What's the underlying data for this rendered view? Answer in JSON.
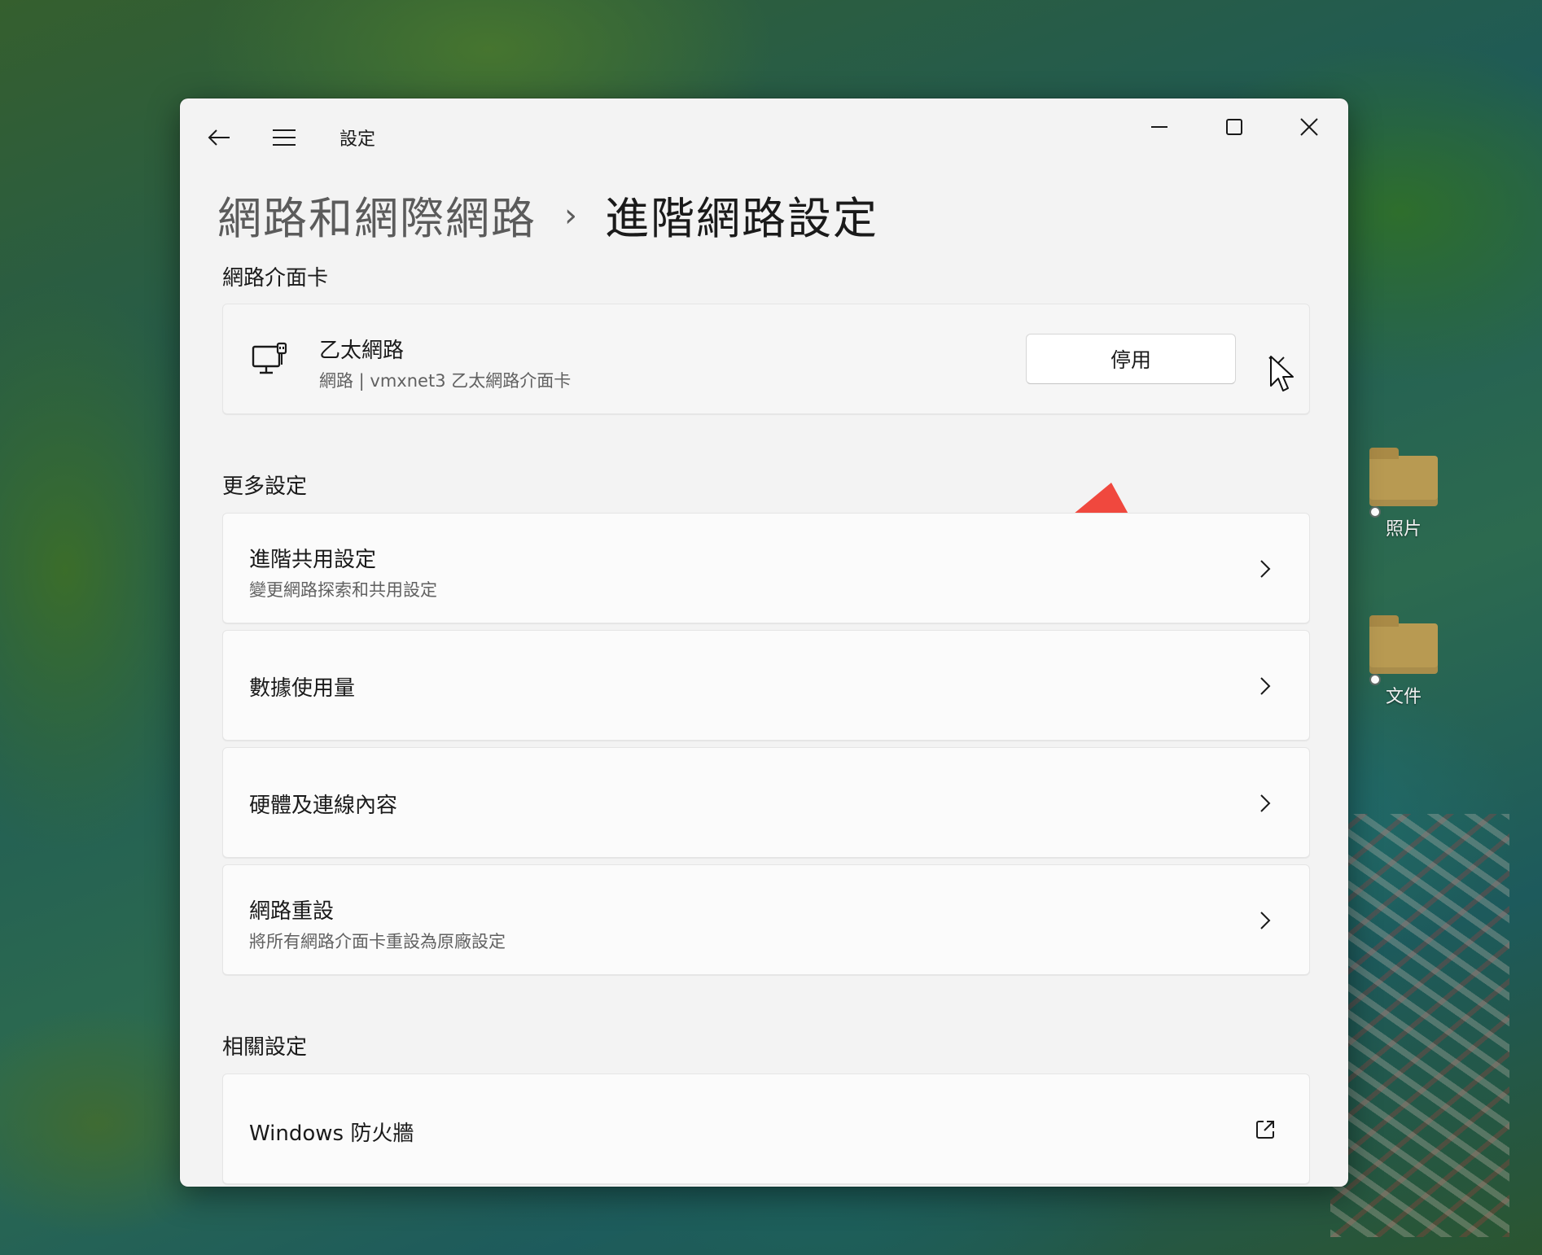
{
  "desktop": {
    "icons": [
      {
        "label": "照片"
      },
      {
        "label": "文件"
      }
    ]
  },
  "window": {
    "app_title": "設定",
    "breadcrumb": {
      "parent": "網路和網際網路",
      "separator": "›",
      "current": "進階網路設定"
    },
    "sections": {
      "adapters": "網路介面卡",
      "more": "更多設定",
      "related": "相關設定"
    },
    "adapter": {
      "name": "乙太網路",
      "description": "網路 | vmxnet3 乙太網路介面卡",
      "disable_label": "停用"
    },
    "more_items": [
      {
        "title": "進階共用設定",
        "subtitle": "變更網路探索和共用設定"
      },
      {
        "title": "數據使用量",
        "subtitle": ""
      },
      {
        "title": "硬體及連線內容",
        "subtitle": ""
      },
      {
        "title": "網路重設",
        "subtitle": "將所有網路介面卡重設為原廠設定"
      }
    ],
    "related_items": [
      {
        "title": "Windows 防火牆"
      }
    ],
    "icons": {
      "back": "back-arrow-icon",
      "menu": "hamburger-menu-icon",
      "minimize": "minimize-icon",
      "maximize": "maximize-icon",
      "close": "close-icon",
      "adapter": "ethernet-computer-icon",
      "chevron": "chevron-right-icon",
      "external": "external-link-icon"
    },
    "colors": {
      "annotation_arrow": "#f0483e",
      "window_bg": "#f3f3f3",
      "card_bg": "#fbfbfb"
    }
  }
}
